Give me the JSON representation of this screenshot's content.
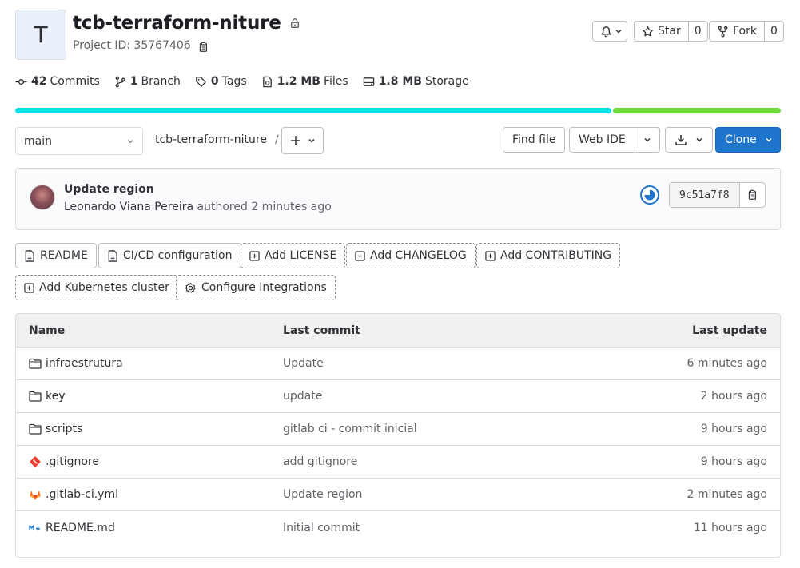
{
  "project": {
    "avatar_letter": "T",
    "name": "tcb-terraform-niture",
    "id_label": "Project ID: 35767406"
  },
  "actions": {
    "star_label": "Star",
    "star_count": "0",
    "fork_label": "Fork",
    "fork_count": "0"
  },
  "stats": {
    "commits_count": "42",
    "commits_label": "Commits",
    "branch_count": "1",
    "branch_label": "Branch",
    "tags_count": "0",
    "tags_label": "Tags",
    "files_size": "1.2 MB",
    "files_label": "Files",
    "storage_size": "1.8 MB",
    "storage_label": "Storage"
  },
  "languages": [
    {
      "color": "#06e3e4",
      "fraction": 0.78
    },
    {
      "color": "#6bdc3a",
      "fraction": 0.22
    }
  ],
  "toolbar": {
    "branch": "main",
    "breadcrumb": "tcb-terraform-niture",
    "breadcrumb_sep": "/",
    "find_file": "Find file",
    "web_ide": "Web IDE",
    "clone": "Clone"
  },
  "last_commit": {
    "title": "Update region",
    "author": "Leonardo Viana Pereira",
    "verb": "authored",
    "time": "2 minutes ago",
    "sha": "9c51a7f8"
  },
  "quick_actions": {
    "readme": "README",
    "cicd": "CI/CD configuration",
    "license": "Add LICENSE",
    "changelog": "Add CHANGELOG",
    "contributing": "Add CONTRIBUTING",
    "kubernetes": "Add Kubernetes cluster",
    "integrations": "Configure Integrations"
  },
  "file_table": {
    "headers": {
      "name": "Name",
      "commit": "Last commit",
      "update": "Last update"
    },
    "rows": [
      {
        "name": "infraestrutura",
        "icon": "folder-icon",
        "commit": "Update",
        "updated": "6 minutes ago"
      },
      {
        "name": "key",
        "icon": "folder-icon",
        "commit": "update",
        "updated": "2 hours ago"
      },
      {
        "name": "scripts",
        "icon": "folder-icon",
        "commit": "gitlab ci - commit inicial",
        "updated": "9 hours ago"
      },
      {
        "name": ".gitignore",
        "icon": "git-icon",
        "commit": "add gitignore",
        "updated": "9 hours ago"
      },
      {
        "name": ".gitlab-ci.yml",
        "icon": "gitlab-icon",
        "commit": "Update region",
        "updated": "2 minutes ago"
      },
      {
        "name": "README.md",
        "icon": "markdown-icon",
        "commit": "Initial commit",
        "updated": "11 hours ago"
      }
    ]
  }
}
